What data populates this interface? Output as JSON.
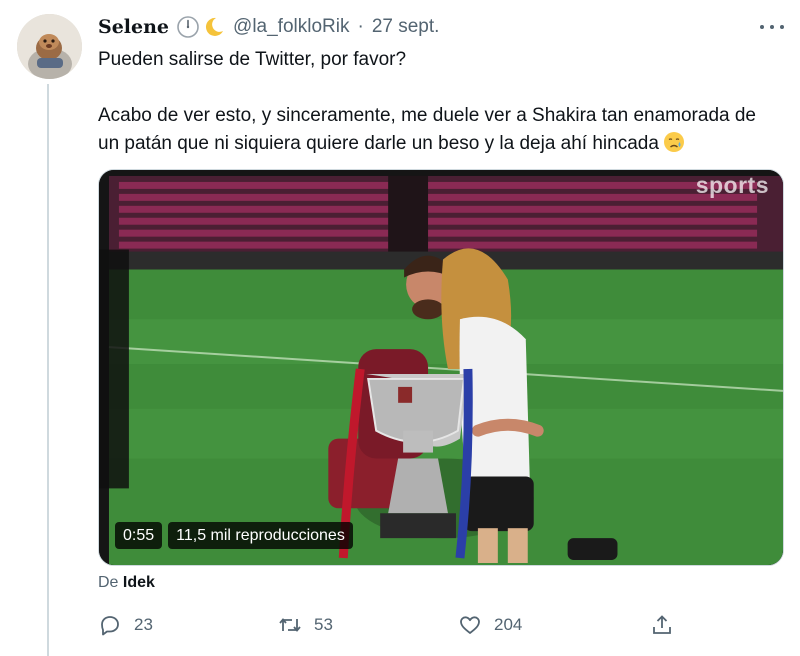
{
  "tweet": {
    "author_name": "Selene",
    "handle": "@la_folkloRik",
    "separator": "·",
    "date": "27 sept.",
    "icons": [
      "clock-emoji-icon",
      "crescent-moon-emoji-icon"
    ],
    "text_line1": "Pueden salirse de Twitter, por favor?",
    "text_paragraph2": "Acabo de ver esto, y sinceramente, me duele ver a Shakira tan enamorada de un patán que ni siquiera quiere darle un beso y la deja ahí hincada",
    "trailing_emoji": "sad-but-relieved-face-emoji-icon"
  },
  "media": {
    "watermark": "sports",
    "duration": "0:55",
    "views": "11,5 mil reproducciones"
  },
  "source": {
    "prefix": "De",
    "name": "Idek"
  },
  "actions": {
    "replies": "23",
    "retweets": "53",
    "likes": "204"
  },
  "colors": {
    "text": "#0f1419",
    "secondary": "#536471",
    "border": "#cfd9de",
    "pitch": "#3f8c3a",
    "seats": "#8a2a54"
  }
}
